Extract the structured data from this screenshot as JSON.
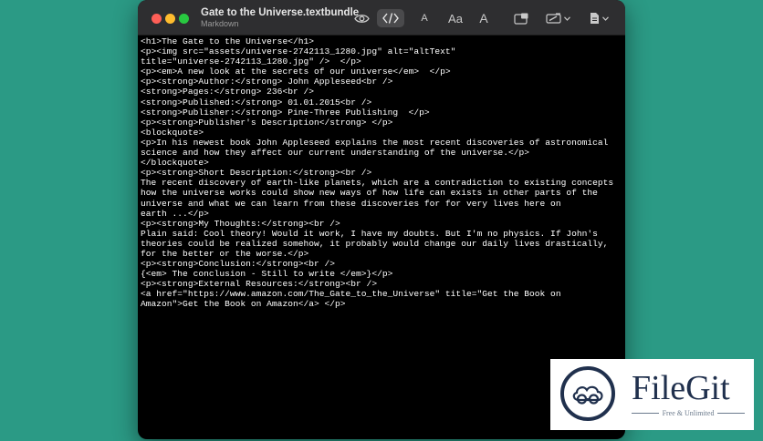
{
  "window": {
    "title": "Gate to the Universe.textbundle",
    "subtitle": "Markdown"
  },
  "toolbar": {
    "items": [
      {
        "name": "preview-eye-icon",
        "active": false
      },
      {
        "name": "code-icon",
        "active": true
      },
      {
        "name": "font-size-small",
        "label": "A"
      },
      {
        "name": "font-face",
        "label": "Aa"
      },
      {
        "name": "font-size-large",
        "label": "A"
      },
      {
        "name": "layout-icon"
      },
      {
        "name": "theme-icon"
      },
      {
        "name": "export-icon"
      }
    ]
  },
  "editor": {
    "lines": [
      "<h1>The Gate to the Universe</h1>",
      "<p><img src=\"assets/universe-2742113_1280.jpg\" alt=\"altText\"",
      "title=\"universe-2742113_1280.jpg\" />  </p>",
      "<p><em>A new look at the secrets of our universe</em>  </p>",
      "<p><strong>Author:</strong> John Appleseed<br />",
      "<strong>Pages:</strong> 236<br />",
      "<strong>Published:</strong> 01.01.2015<br />",
      "<strong>Publisher:</strong> Pine-Three Publishing  </p>",
      "<p><strong>Publisher's Description</strong> </p>",
      "<blockquote>",
      "<p>In his newest book John Appleseed explains the most recent discoveries of astronomical",
      "science and how they affect our current understanding of the universe.</p>",
      "</blockquote>",
      "<p><strong>Short Description:</strong><br />",
      "The recent discovery of earth-like planets, which are a contradiction to existing concepts",
      "how the universe works could show new ways of how life can exists in other parts of the",
      "universe and what we can learn from these discoveries for for very lives here on",
      "earth ...</p>",
      "<p><strong>My Thoughts:</strong><br />",
      "Plain said: Cool theory! Would it work, I have my doubts. But I'm no physics. If John's",
      "theories could be realized somehow, it probably would change our daily lives drastically,",
      "for the better or the worse.</p>",
      "<p><strong>Conclusion:</strong><br />",
      "{<em> The conclusion - Still to write </em>}</p>",
      "<p><strong>External Resources:</strong><br />",
      "<a href=\"https://www.amazon.com/The_Gate_to_the_Universe\" title=\"Get the Book on",
      "Amazon\">Get the Book on Amazon</a> </p>"
    ]
  },
  "watermark": {
    "name": "FileGit",
    "tagline": "Free & Unlimited"
  },
  "colors": {
    "desktop": "#2b9a85",
    "titlebar": "#2e2e30",
    "editor_bg": "#000000",
    "editor_text": "#ffffff",
    "logo_navy": "#20304d"
  }
}
